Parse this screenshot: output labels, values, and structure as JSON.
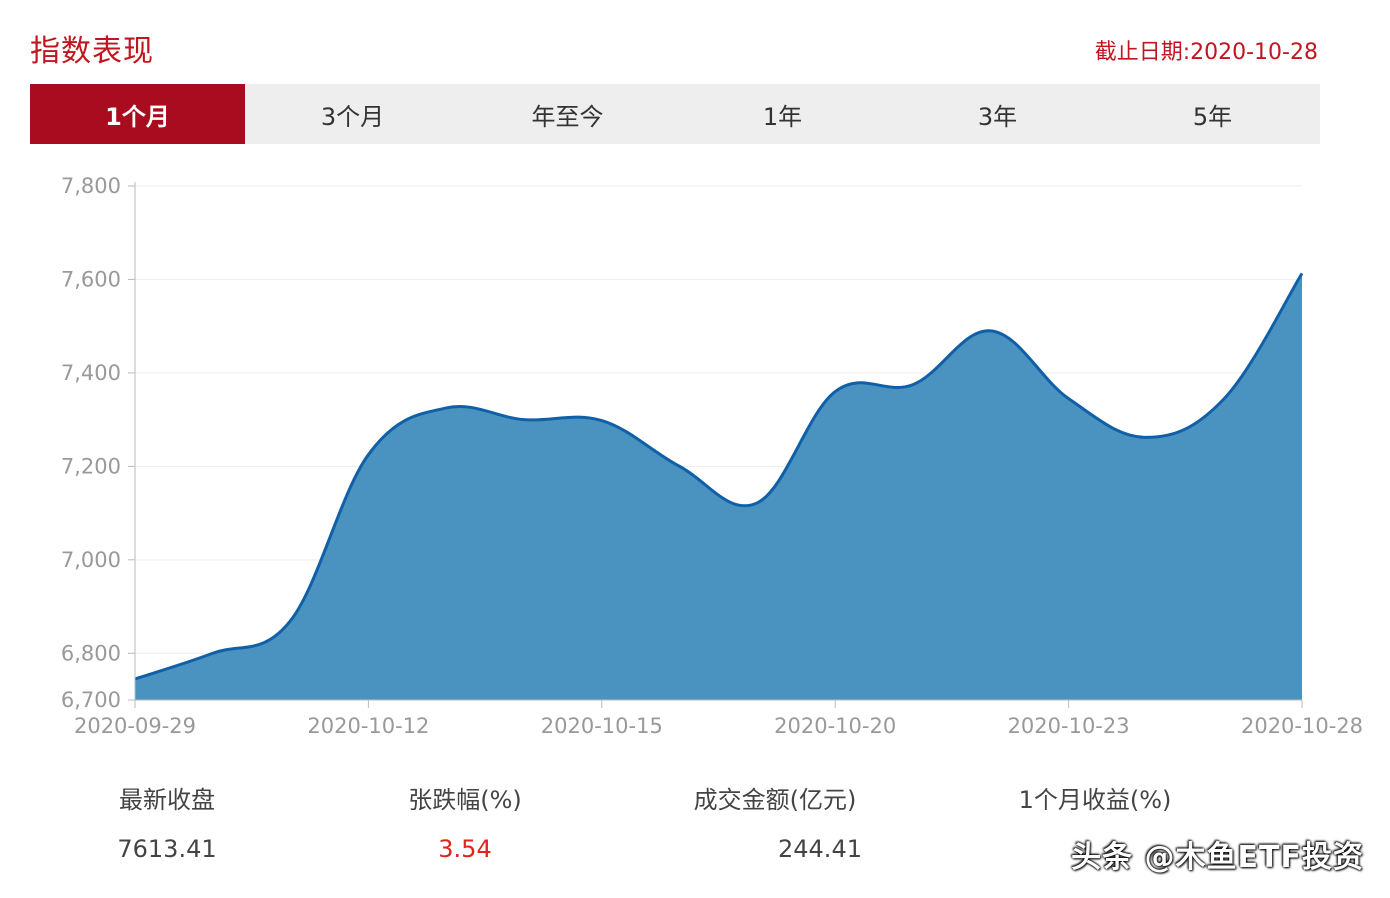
{
  "header": {
    "title": "指数表现",
    "date_label": "截止日期:2020-10-28"
  },
  "tabs": [
    {
      "label": "1个月",
      "active": true
    },
    {
      "label": "3个月",
      "active": false
    },
    {
      "label": "年至今",
      "active": false
    },
    {
      "label": "1年",
      "active": false
    },
    {
      "label": "3年",
      "active": false
    },
    {
      "label": "5年",
      "active": false
    }
  ],
  "colors": {
    "accent": "#a90c1e",
    "area_fill": "#4a93c0",
    "line": "#1060a8",
    "positive": "#e0231b"
  },
  "chart_data": {
    "type": "area",
    "x": [
      "2020-09-29",
      "2020-09-30",
      "2020-10-09",
      "2020-10-12",
      "2020-10-13",
      "2020-10-14",
      "2020-10-15",
      "2020-10-16",
      "2020-10-19",
      "2020-10-20",
      "2020-10-21",
      "2020-10-22",
      "2020-10-23",
      "2020-10-26",
      "2020-10-27",
      "2020-10-28"
    ],
    "values": [
      6745,
      6800,
      6870,
      7225,
      7325,
      7300,
      7298,
      7200,
      7122,
      7360,
      7375,
      7490,
      7345,
      7262,
      7345,
      7613
    ],
    "xticks": [
      "2020-09-29",
      "2020-10-12",
      "2020-10-15",
      "2020-10-20",
      "2020-10-23",
      "2020-10-28"
    ],
    "yticks": [
      "6,700",
      "6,800",
      "7,000",
      "7,200",
      "7,400",
      "7,600",
      "7,800"
    ],
    "ytick_values": [
      6700,
      6800,
      7000,
      7200,
      7400,
      7600,
      7800
    ],
    "ylim": [
      6700,
      7800
    ],
    "grid": true,
    "legend": "none"
  },
  "stats": [
    {
      "label": "最新收盘",
      "value": "7613.41",
      "highlight": false
    },
    {
      "label": "张跌幅(%)",
      "value": "3.54",
      "highlight": true
    },
    {
      "label": "成交金额(亿元)",
      "value": "244.41",
      "highlight": false
    },
    {
      "label": "1个月收益(%)",
      "value": "",
      "highlight": true
    }
  ],
  "watermark": "头条 @木鱼ETF投资"
}
